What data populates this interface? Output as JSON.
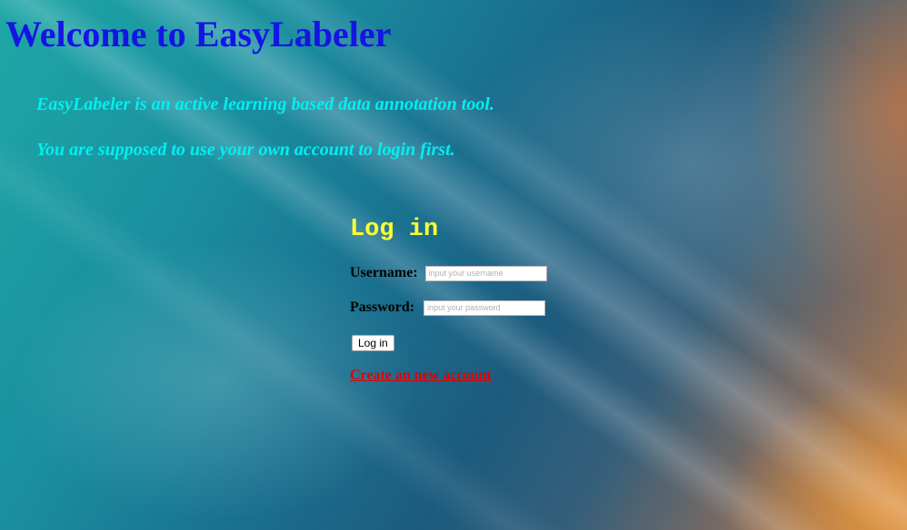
{
  "header": {
    "title": "Welcome to EasyLabeler"
  },
  "intro": {
    "line1": "EasyLabeler is an active learning based data annotation tool.",
    "line2": "You are supposed to use your own account to login first."
  },
  "login_form": {
    "heading": "Log in",
    "username_label": "Username:",
    "username_placeholder": "input your username",
    "username_value": "",
    "password_label": "Password:",
    "password_placeholder": "input your password",
    "password_value": "",
    "submit_label": "Log in",
    "create_account_link": "Create an new account"
  },
  "colors": {
    "title": "#1414e6",
    "intro_text": "#00f0f0",
    "login_heading": "#ffff33",
    "create_account_link": "#e00000"
  }
}
